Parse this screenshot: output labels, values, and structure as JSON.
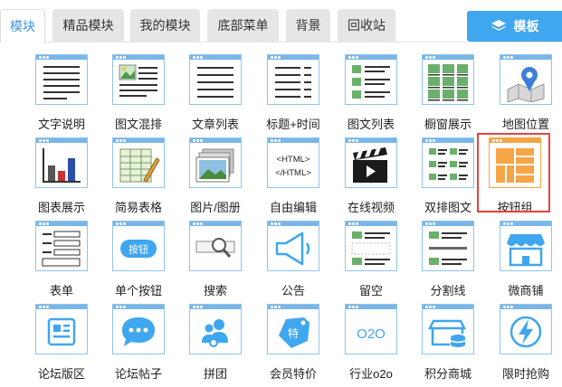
{
  "tabs": [
    {
      "label": "模块",
      "active": true
    },
    {
      "label": "精品模块"
    },
    {
      "label": "我的模块"
    },
    {
      "label": "底部菜单"
    },
    {
      "label": "背景"
    },
    {
      "label": "回收站"
    }
  ],
  "template_button": {
    "label": "模板",
    "icon": "layers-icon"
  },
  "modules": [
    [
      "文字说明",
      "图文混排",
      "文章列表",
      "标题+时间",
      "图文列表",
      "橱窗展示",
      "地图位置"
    ],
    [
      "图表展示",
      "简易表格",
      "图片/图册",
      "自由编辑",
      "在线视频",
      "双排图文",
      "按钮组"
    ],
    [
      "表单",
      "单个按钮",
      "搜索",
      "公告",
      "留空",
      "分割线",
      "微商铺"
    ],
    [
      "论坛版区",
      "论坛帖子",
      "拼团",
      "会员特价",
      "行业o2o",
      "积分商城",
      "限时抢购"
    ]
  ],
  "icon_text": {
    "html_open": "<HTML>",
    "html_close": "</HTML>",
    "button": "按钮",
    "o2o": "O2O",
    "member": "特"
  },
  "selected_module": "按钮组",
  "colors": {
    "accent": "#3fa6f0",
    "selected": "#f5a546",
    "highlight": "#e8423e"
  }
}
